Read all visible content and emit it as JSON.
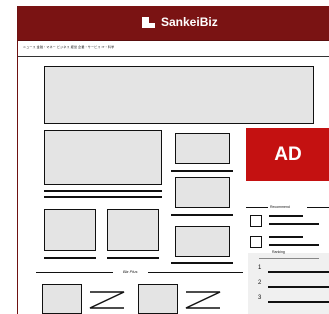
{
  "header": {
    "brand": "SankeiBiz",
    "logo_icon": "newspaper-logo-icon",
    "background": "#7a1313"
  },
  "nav": {
    "text": "ニュース 金融・マネー ビジネス 経営 企業・サービス IT・科学"
  },
  "ad": {
    "label": "AD",
    "color": "#c41111"
  },
  "sections": {
    "biz_plus": "Biz Plus",
    "recommend": "Recommend",
    "ranking": "Ranking"
  },
  "ranking": {
    "items": [
      "1",
      "2",
      "3"
    ]
  }
}
